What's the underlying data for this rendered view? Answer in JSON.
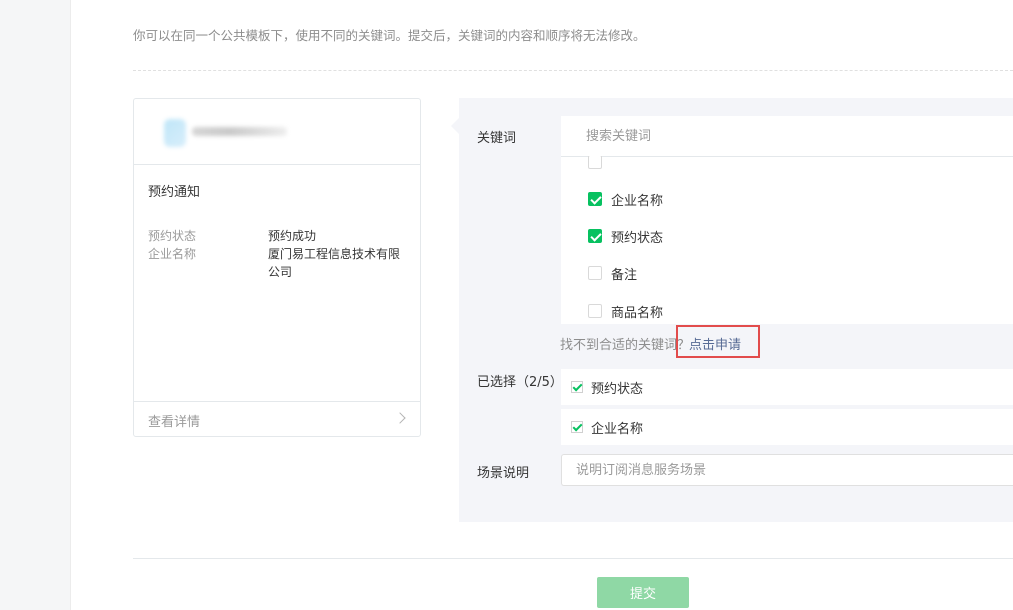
{
  "hint_text": "你可以在同一个公共模板下，使用不同的关键词。提交后，关键词的内容和顺序将无法修改。",
  "preview": {
    "title": "预约通知",
    "fields": [
      {
        "label": "预约状态",
        "value": "预约成功"
      },
      {
        "label": "企业名称",
        "value": "厦门易工程信息技术有限公司"
      }
    ],
    "details_link": "查看详情"
  },
  "keywords": {
    "label": "关键词",
    "search_placeholder": "搜索关键词",
    "options": [
      {
        "label": "",
        "checked": false
      },
      {
        "label": "企业名称",
        "checked": true
      },
      {
        "label": "预约状态",
        "checked": true
      },
      {
        "label": "备注",
        "checked": false
      },
      {
        "label": "商品名称",
        "checked": false
      }
    ],
    "cant_find": "找不到合适的关键词？",
    "apply_link": "点击申请"
  },
  "selected": {
    "label": "已选择（2/5）",
    "items": [
      "预约状态",
      "企业名称"
    ]
  },
  "scene": {
    "label": "场景说明",
    "placeholder": "说明订阅消息服务场景"
  },
  "submit_label": "提交",
  "colors": {
    "accent": "#07c160",
    "link": "#576b95",
    "highlight": "#e24c4c",
    "submit_disabled": "#8fd8a5"
  }
}
